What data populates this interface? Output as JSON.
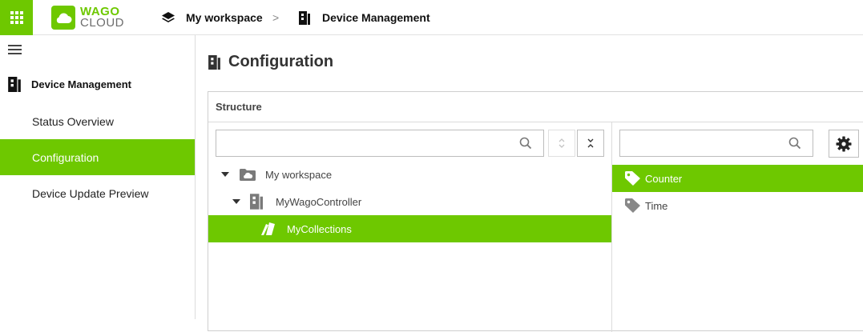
{
  "app": {
    "logo_line1": "WAGO",
    "logo_line2": "CLOUD",
    "accent_color": "#6ec800"
  },
  "breadcrumb": {
    "workspace": "My workspace",
    "separator": ">",
    "current": "Device Management"
  },
  "sidebar": {
    "section_title": "Device Management",
    "items": [
      {
        "label": "Status Overview",
        "active": false
      },
      {
        "label": "Configuration",
        "active": true
      },
      {
        "label": "Device Update Preview",
        "active": false
      }
    ]
  },
  "main": {
    "title": "Configuration",
    "panel_header": "Structure",
    "tree": {
      "search_value": "",
      "nodes": [
        {
          "label": "My workspace",
          "icon": "cloud-folder-icon",
          "expanded": true
        },
        {
          "label": "MyWagoController",
          "icon": "controller-icon",
          "expanded": true
        },
        {
          "label": "MyCollections",
          "icon": "collection-icon",
          "selected": true
        }
      ]
    },
    "tags": {
      "search_value": "",
      "items": [
        {
          "label": "Counter",
          "icon": "tag-icon",
          "selected": true
        },
        {
          "label": "Time",
          "icon": "tag-icon",
          "selected": false
        }
      ]
    }
  }
}
